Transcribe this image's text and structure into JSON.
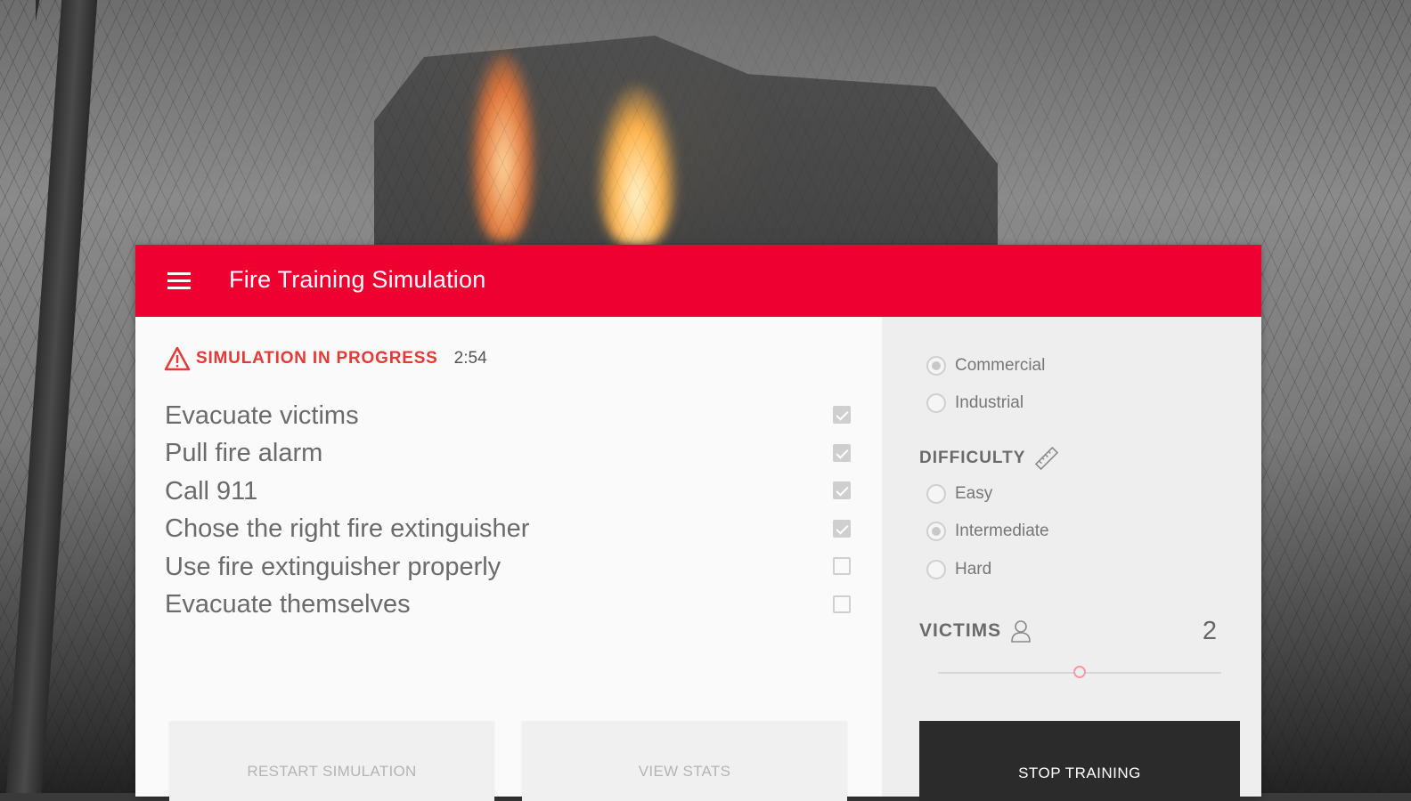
{
  "app": {
    "title": "Fire Training Simulation"
  },
  "status": {
    "text": "SIMULATION IN PROGRESS",
    "timer": "2:54"
  },
  "tasks": [
    {
      "label": "Evacuate victims",
      "checked": true
    },
    {
      "label": "Pull fire alarm",
      "checked": true
    },
    {
      "label": "Call 911",
      "checked": true
    },
    {
      "label": "Chose the right fire extinguisher",
      "checked": true
    },
    {
      "label": "Use fire extinguisher properly",
      "checked": false
    },
    {
      "label": "Evacuate themselves",
      "checked": false
    }
  ],
  "buttons": {
    "restart": "RESTART SIMULATION",
    "stats": "VIEW STATS",
    "stop": "STOP TRAINING"
  },
  "building_type": {
    "options": [
      {
        "label": "Commercial",
        "selected": true
      },
      {
        "label": "Industrial",
        "selected": false
      }
    ]
  },
  "difficulty": {
    "label": "DIFFICULTY",
    "options": [
      {
        "label": "Easy",
        "selected": false
      },
      {
        "label": "Intermediate",
        "selected": true
      },
      {
        "label": "Hard",
        "selected": false
      }
    ]
  },
  "victims": {
    "label": "VICTIMS",
    "count": "2",
    "slider_fraction": 0.5
  },
  "colors": {
    "accent": "#ee0030",
    "warning": "#e53935",
    "stop_button": "#2b2b2b"
  },
  "icons": [
    "menu-icon",
    "warning-icon",
    "ruler-icon",
    "person-icon"
  ]
}
